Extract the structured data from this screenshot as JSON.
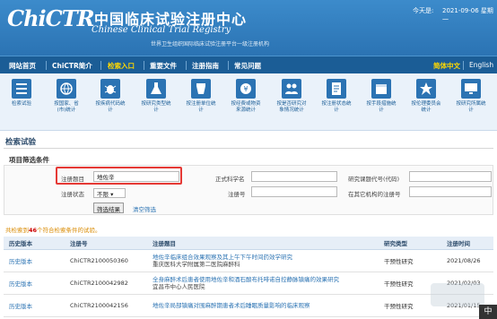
{
  "header": {
    "logo": "ChiCTR",
    "title_cn": "中国临床试验注册中心",
    "title_en": "Chinese Clinical Trial Registry",
    "subtitle": "世界卫生组织国际临床试验注册平台一级注册机构",
    "date_label": "今天是:",
    "date_value": "2021-09-06 星期一"
  },
  "nav": {
    "items": [
      "网站首页",
      "ChiCTR简介",
      "检索入口",
      "重要文件",
      "注册指南",
      "常见问题"
    ],
    "active_index": 2,
    "lang_cn": "简体中文",
    "lang_en": "English"
  },
  "iconbar": {
    "items": [
      {
        "icon": "search-list-icon",
        "label": "检索试验"
      },
      {
        "icon": "globe-icon",
        "label": "按国家、省(市)统计"
      },
      {
        "icon": "bug-icon",
        "label": "按疾病代码统计"
      },
      {
        "icon": "flask-icon",
        "label": "按研究类型统计"
      },
      {
        "icon": "beaker-icon",
        "label": "按注册单位统计"
      },
      {
        "icon": "coin-icon",
        "label": "按经费或物资来源统计"
      },
      {
        "icon": "people-icon",
        "label": "按是否研究对象情况统计"
      },
      {
        "icon": "document-icon",
        "label": "按注册状态统计"
      },
      {
        "icon": "calendar-icon",
        "label": "按手段措施统计"
      },
      {
        "icon": "star-icon",
        "label": "按伦理委员会统计"
      },
      {
        "icon": "monitor-icon",
        "label": "按研究所属统计"
      }
    ]
  },
  "search": {
    "section_title": "检索试验",
    "filter_title": "项目筛选条件",
    "reg_title_label": "注册题目",
    "reg_title_value": "地佐辛",
    "reg_status_label": "注册状态",
    "reg_status_value": "不限",
    "sponsor_label": "正式科学名",
    "reg_number_label": "注册号",
    "secondary_id_label": "研究课题代号(代码)",
    "other_org_label": "在其它机构的注册号",
    "submit_label": "筛选结果",
    "clear_label": "清空筛选"
  },
  "results": {
    "note_prefix": "共检索到",
    "count": "46",
    "note_suffix": "个符合检索条件的试验。",
    "columns": [
      "历史版本",
      "注册号",
      "注册题目",
      "研究类型",
      "注册时间"
    ],
    "rows": [
      {
        "history": "历史版本",
        "reg_no": "ChiCTR2100050360",
        "title": "地佐辛临床组合效果观察及其上午下午时间药效学研究",
        "org": "重庆医科大学附属第二医院麻醉科",
        "type": "干预性研究",
        "date": "2021/08/26"
      },
      {
        "history": "历史版本",
        "reg_no": "ChiCTR2100042982",
        "title": "全身麻醉术后患者使用地佐辛和酒石酸布托啡诺自控静脉镇痛的效果研究",
        "org": "宜昌市中心人民医院",
        "type": "干预性研究",
        "date": "2021/02/03"
      },
      {
        "history": "历史版本",
        "reg_no": "ChiCTR2100042156",
        "title": "地佐辛局部镇痛对围麻醉期患者术后睡眠质量影响的临床观察",
        "org": "",
        "type": "干预性研究",
        "date": "2021/01/15"
      }
    ]
  },
  "overlay": {
    "ime": "中"
  }
}
